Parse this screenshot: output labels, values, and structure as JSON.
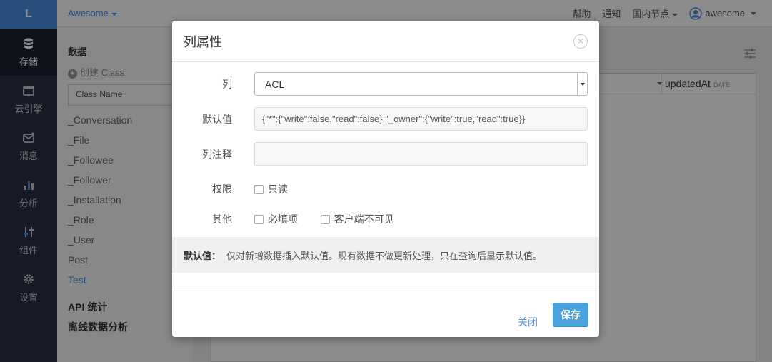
{
  "nav": {
    "logo": "L",
    "items": [
      {
        "label": "存储",
        "icon": "database-icon"
      },
      {
        "label": "云引擎",
        "icon": "server-icon"
      },
      {
        "label": "消息",
        "icon": "message-icon"
      },
      {
        "label": "分析",
        "icon": "bar-chart-icon"
      },
      {
        "label": "组件",
        "icon": "sliders-icon"
      },
      {
        "label": "设置",
        "icon": "gear-icon"
      }
    ],
    "active_index": 0
  },
  "topbar": {
    "app_name": "Awesome",
    "help": "帮助",
    "notify": "通知",
    "region": "国内节点",
    "username": "awesome"
  },
  "side": {
    "data_heading": "数据",
    "create_class": "创建 Class",
    "search_placeholder": "Class Name",
    "classes": [
      "_Conversation",
      "_File",
      "_Followee",
      "_Follower",
      "_Installation",
      "_Role",
      "_User",
      "Post",
      "Test"
    ],
    "active_class": "Test",
    "api_stats": "API 统计",
    "offline_analysis": "离线数据分析"
  },
  "table": {
    "column_name": "updatedAt",
    "column_type": "DATE"
  },
  "modal": {
    "title": "列属性",
    "close_symbol": "×",
    "column_label": "列",
    "column_value": "ACL",
    "default_label": "默认值",
    "default_value": "{\"*\":{\"write\":false,\"read\":false},\"_owner\":{\"write\":true,\"read\":true}}",
    "comment_label": "列注释",
    "comment_value": "",
    "permission_label": "权限",
    "readonly_label": "只读",
    "other_label": "其他",
    "required_label": "必填项",
    "client_invisible_label": "客户端不可见",
    "help_title": "默认值：",
    "help_text": "仅对新增数据插入默认值。现有数据不做更新处理，只在查询后显示默认值。",
    "close_button": "关闭",
    "save_button": "保存"
  },
  "colors": {
    "accent": "#4a90e2",
    "nav_bg": "#2b3142",
    "primary_button": "#4aa3df"
  }
}
